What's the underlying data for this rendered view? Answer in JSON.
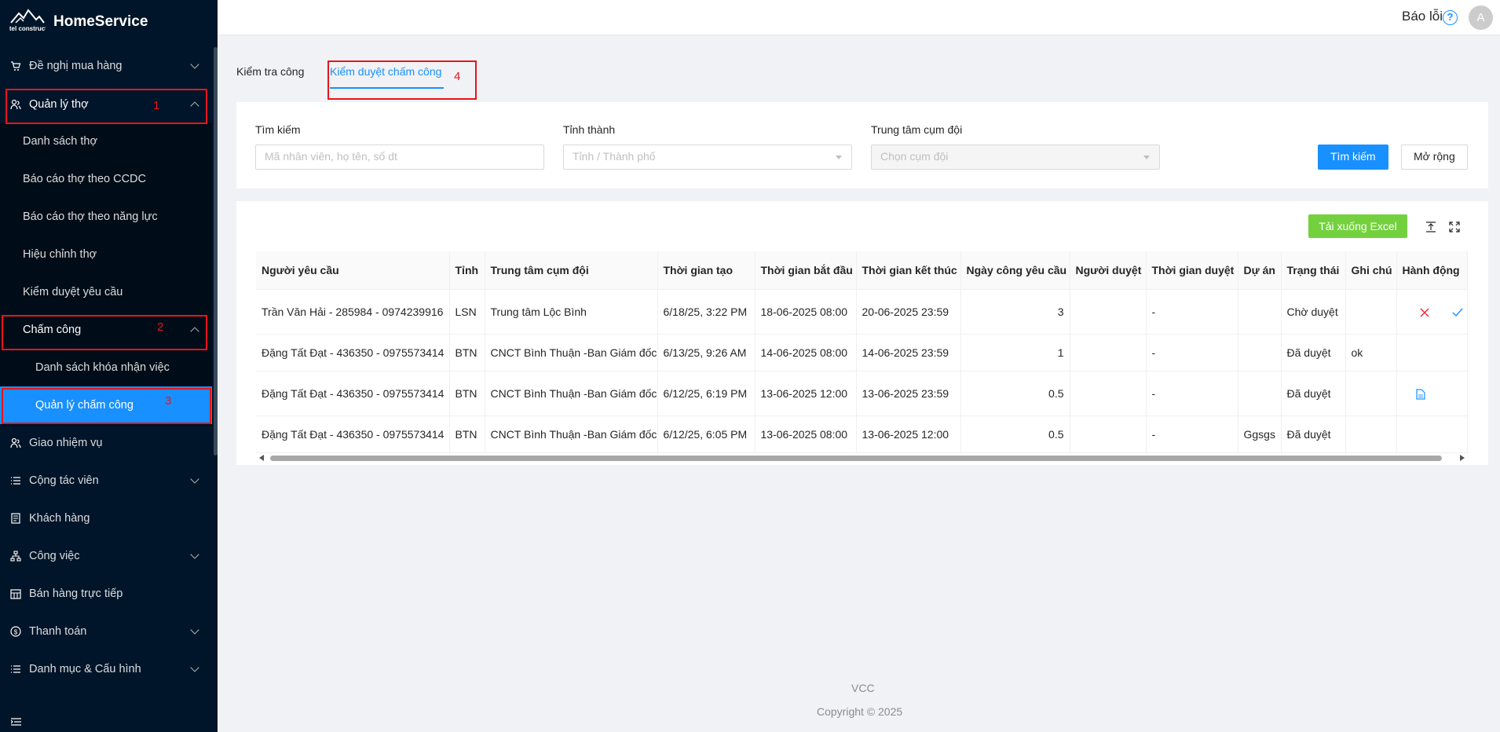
{
  "app": {
    "name": "HomeService",
    "logo_text": "viettel construction"
  },
  "header": {
    "report_bug": "Báo lỗi",
    "avatar_initial": "A"
  },
  "sidebar": {
    "items": [
      {
        "label": "Đề nghị mua hàng",
        "icon": "cart-icon"
      },
      {
        "label": "Quản lý thợ",
        "icon": "workers-icon"
      },
      {
        "label": "Danh sách thợ"
      },
      {
        "label": "Báo cáo thợ theo CCDC"
      },
      {
        "label": "Báo cáo thợ theo năng lực"
      },
      {
        "label": "Hiệu chỉnh thợ"
      },
      {
        "label": "Kiểm duyệt yêu cầu"
      },
      {
        "label": "Chấm công"
      },
      {
        "label": "Danh sách khóa nhận việc"
      },
      {
        "label": "Quản lý chấm công"
      },
      {
        "label": "Giao nhiệm vụ",
        "icon": "assign-icon"
      },
      {
        "label": "Cộng tác viên",
        "icon": "list-icon"
      },
      {
        "label": "Khách hàng",
        "icon": "customer-icon"
      },
      {
        "label": "Công việc",
        "icon": "tasks-icon"
      },
      {
        "label": "Bán hàng trực tiếp",
        "icon": "store-icon"
      },
      {
        "label": "Thanh toán",
        "icon": "payment-icon"
      },
      {
        "label": "Danh mục & Cấu hình",
        "icon": "list-icon"
      }
    ]
  },
  "annotations": [
    "1",
    "2",
    "3",
    "4"
  ],
  "tabs": [
    {
      "label": "Kiểm tra công"
    },
    {
      "label": "Kiểm duyệt chấm công"
    }
  ],
  "filters": {
    "search_label": "Tìm kiếm",
    "search_placeholder": "Mã nhân viên, họ tên, số dt",
    "province_label": "Tỉnh thành",
    "province_placeholder": "Tỉnh / Thành phố",
    "center_label": "Trung tâm cụm đội",
    "center_placeholder": "Chọn cụm đội",
    "search_button": "Tìm kiếm",
    "expand_button": "Mở rộng"
  },
  "table": {
    "export_button": "Tải xuống Excel",
    "columns": [
      "Người yêu cầu",
      "Tỉnh",
      "Trung tâm cụm đội",
      "Thời gian tạo",
      "Thời gian bắt đầu",
      "Thời gian kết thúc",
      "Ngày công yêu cầu",
      "Người duyệt",
      "Thời gian duyệt",
      "Dự án",
      "Trạng thái",
      "Ghi chú",
      "Hành động"
    ],
    "rows": [
      [
        "Trần Văn Hải - 285984 - 0974239916",
        "LSN",
        "Trung tâm Lộc Bình",
        "6/18/25, 3:22 PM",
        "18-06-2025 08:00",
        "20-06-2025 23:59",
        "3",
        "",
        "-",
        "",
        "Chờ duyệt",
        "",
        ""
      ],
      [
        "Đặng Tất Đạt - 436350 - 0975573414",
        "BTN",
        "CNCT Bình Thuận -Ban Giám đốc",
        "6/13/25, 9:26 AM",
        "14-06-2025 08:00",
        "14-06-2025 23:59",
        "1",
        "",
        "-",
        "",
        "Đã duyệt",
        "ok",
        ""
      ],
      [
        "Đặng Tất Đạt - 436350 - 0975573414",
        "BTN",
        "CNCT Bình Thuận -Ban Giám đốc",
        "6/12/25, 6:19 PM",
        "13-06-2025 12:00",
        "13-06-2025 23:59",
        "0.5",
        "",
        "-",
        "",
        "Đã duyệt",
        "",
        ""
      ],
      [
        "Đặng Tất Đạt - 436350 - 0975573414",
        "BTN",
        "CNCT Bình Thuận -Ban Giám đốc",
        "6/12/25, 6:05 PM",
        "13-06-2025 08:00",
        "13-06-2025 12:00",
        "0.5",
        "",
        "-",
        "Ggsgs",
        "Đã duyệt",
        "",
        ""
      ]
    ]
  },
  "footer": {
    "line1": "VCC",
    "line2": "Copyright © 2025"
  },
  "colors": {
    "sidebar": "#001529",
    "primary": "#1890ff",
    "excel": "#73d13d",
    "annotation": "#e8141b"
  }
}
